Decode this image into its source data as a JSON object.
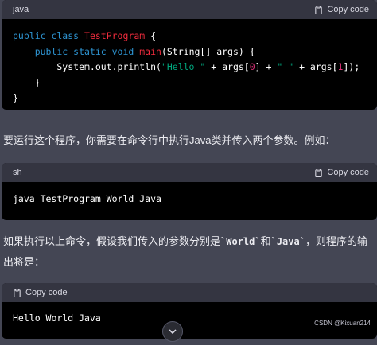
{
  "block1": {
    "lang": "java",
    "copy_label": "Copy code",
    "lines": {
      "l1": {
        "a": "public class ",
        "b": "TestProgram",
        "c": " {"
      },
      "l2": {
        "a": "    public static void ",
        "b": "main",
        "c": "(String[] args) {"
      },
      "l3": {
        "a": "        System.out.println(",
        "s1": "\"Hello \"",
        "p1": " + args[",
        "n0": "0",
        "p2": "] + ",
        "s2": "\" \"",
        "p3": " + args[",
        "n1": "1",
        "p4": "]);"
      },
      "l4": "    }",
      "l5": "}"
    }
  },
  "para1": "要运行这个程序，你需要在命令行中执行Java类并传入两个参数。例如：",
  "block2": {
    "lang": "sh",
    "copy_label": "Copy code",
    "code": "java TestProgram World Java"
  },
  "para2": {
    "t1": "如果执行以上命令，假设我们传入的参数分别是",
    "c1": "`World`",
    "t2": "和",
    "c2": "`Java`",
    "t3": "，则程序的输出将是："
  },
  "block3": {
    "copy_label": "Copy code",
    "code": "Hello World Java"
  },
  "watermark": "CSDN @Kixuan214",
  "icons": [
    "clipboard-icon",
    "chevron-down-icon"
  ]
}
